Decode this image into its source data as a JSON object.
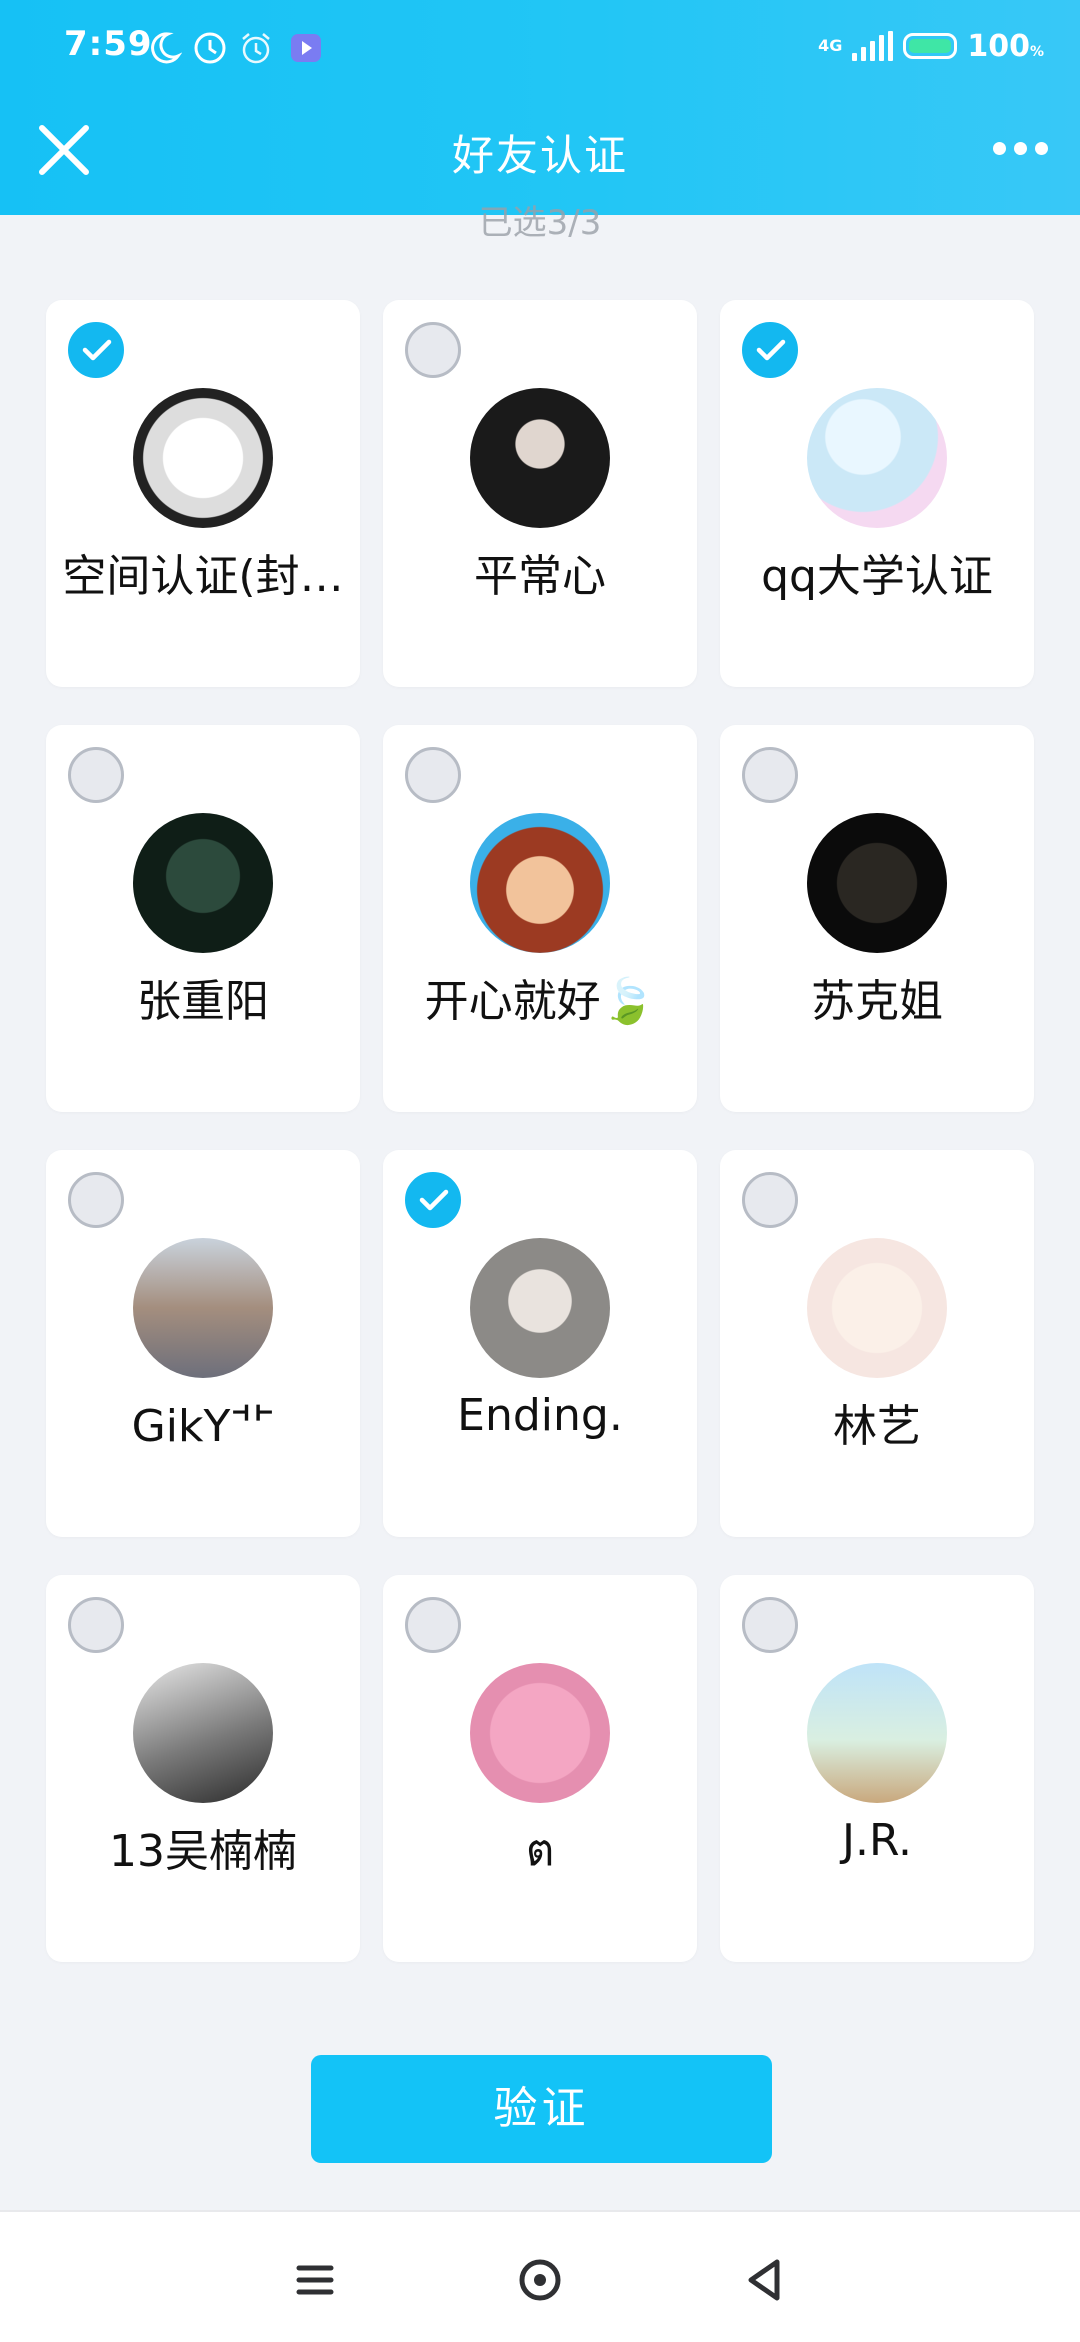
{
  "status_bar": {
    "time": "7:59",
    "network": "4G",
    "battery_percent": "100",
    "battery_unit": "%",
    "icons": [
      "moon-icon",
      "clock-icon",
      "alarm-icon",
      "media-icon",
      "signal-icon",
      "battery-icon"
    ]
  },
  "nav": {
    "title": "好友认证",
    "close_icon": "close-icon",
    "more_icon": "more-icon"
  },
  "hint_text": "已选3/3",
  "friends": [
    {
      "name": "空间认证(封…",
      "selected": true
    },
    {
      "name": "平常心",
      "selected": false
    },
    {
      "name": "qq大学认证",
      "selected": true
    },
    {
      "name": "张重阳",
      "selected": false
    },
    {
      "name": "开心就好🍃",
      "selected": false
    },
    {
      "name": "苏克姐",
      "selected": false
    },
    {
      "name": "GikY⻀",
      "selected": false
    },
    {
      "name": "Ending.",
      "selected": true
    },
    {
      "name": "林艺",
      "selected": false
    },
    {
      "name": "13吴楠楠",
      "selected": false
    },
    {
      "name": "ต",
      "selected": false
    },
    {
      "name": "J.R.",
      "selected": false
    }
  ],
  "verify_button": "验证",
  "colors": {
    "accent": "#13c3f7",
    "header_gradient_start": "#16c1f5",
    "header_gradient_end": "#38c8f7",
    "checked": "#13b8f0"
  },
  "system_nav": [
    "menu-icon",
    "home-icon",
    "back-icon"
  ]
}
